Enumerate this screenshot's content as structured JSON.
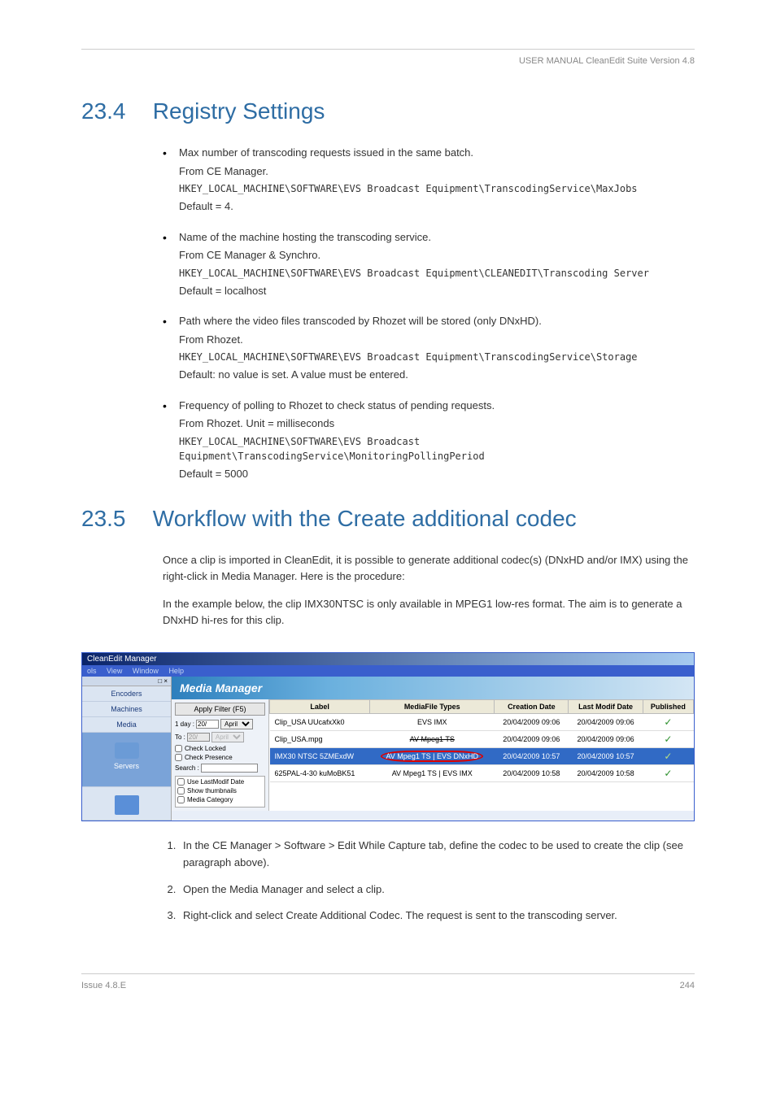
{
  "header": {
    "text": "USER MANUAL CleanEdit Suite Version 4.8"
  },
  "section_234": {
    "number": "23.4",
    "title": "Registry Settings",
    "items": [
      {
        "description": "Max number of transcoding requests issued in the same batch.",
        "source": "From CE Manager.",
        "regkey": "HKEY_LOCAL_MACHINE\\SOFTWARE\\EVS Broadcast Equipment\\TranscodingService\\MaxJobs",
        "default": "Default = 4."
      },
      {
        "description": "Name of the machine hosting the transcoding service.",
        "source": "From CE Manager & Synchro.",
        "regkey": "HKEY_LOCAL_MACHINE\\SOFTWARE\\EVS Broadcast Equipment\\CLEANEDIT\\Transcoding Server",
        "default": "Default = localhost"
      },
      {
        "description": "Path where the video files transcoded by Rhozet will be stored (only DNxHD).",
        "source": "From Rhozet.",
        "regkey": "HKEY_LOCAL_MACHINE\\SOFTWARE\\EVS Broadcast Equipment\\TranscodingService\\Storage",
        "default": "Default: no value is set. A value must be entered."
      },
      {
        "description": "Frequency of polling to Rhozet to check status of pending requests.",
        "source": "From Rhozet. Unit = milliseconds",
        "regkey": "HKEY_LOCAL_MACHINE\\SOFTWARE\\EVS Broadcast Equipment\\TranscodingService\\MonitoringPollingPeriod",
        "default": "Default = 5000"
      }
    ]
  },
  "section_235": {
    "number": "23.5",
    "title": "Workflow with the Create additional codec",
    "intro_p1": "Once a clip is imported in CleanEdit, it is possible to generate additional codec(s) (DNxHD and/or IMX) using the right-click in Media Manager. Here is the procedure:",
    "intro_p2": "In the example below, the clip IMX30NTSC is only available in MPEG1 low-res format. The aim is to generate a DNxHD hi-res for this clip.",
    "steps": [
      "In the CE Manager > Software > Edit While Capture tab, define the codec to be used to create the clip (see paragraph above).",
      "Open the Media Manager and select a clip.",
      "Right-click and select Create Additional Codec. The request is sent to the transcoding server."
    ]
  },
  "screenshot": {
    "title": "CleanEdit Manager",
    "menus": [
      "ols",
      "View",
      "Window",
      "Help"
    ],
    "sidebar_close": "□ ×",
    "sidebar_items": [
      "Encoders",
      "Machines",
      "Media",
      "Servers"
    ],
    "mm_header": "Media Manager",
    "filter_panel": {
      "apply_btn": "Apply Filter (F5)",
      "one_day_label": "1 day :",
      "one_day_val": "20/",
      "one_day_month": "April",
      "to_label": "To :",
      "to_val": "20/",
      "to_month": "April",
      "check_locked": "Check Locked",
      "check_presence": "Check Presence",
      "search_label": "Search :",
      "opt1": "Use LastModif Date",
      "opt2": "Show thumbnails",
      "opt3": "Media Category"
    },
    "table": {
      "headers": [
        "Label",
        "MediaFile Types",
        "Creation Date",
        "Last Modif Date",
        "Published"
      ],
      "rows": [
        {
          "label": "Clip_USA UUcafxXk0",
          "types": "EVS IMX",
          "created": "20/04/2009 09:06",
          "modified": "20/04/2009 09:06",
          "pub": "✓",
          "highlighted": false
        },
        {
          "label": "Clip_USA.mpg",
          "types": "AV Mpeg1 TS",
          "types_strike": true,
          "created": "20/04/2009 09:06",
          "modified": "20/04/2009 09:06",
          "pub": "✓",
          "highlighted": false
        },
        {
          "label": "IMX30 NTSC 5ZMExdW",
          "types": "AV Mpeg1 TS | EVS DNxHD",
          "types_circled": true,
          "created": "20/04/2009 10:57",
          "modified": "20/04/2009 10:57",
          "pub": "✓",
          "highlighted": true
        },
        {
          "label": "625PAL-4-30 kuMoBK51",
          "types": "AV Mpeg1 TS | EVS IMX",
          "created": "20/04/2009 10:58",
          "modified": "20/04/2009 10:58",
          "pub": "✓",
          "highlighted": false
        }
      ]
    }
  },
  "footer": {
    "left": "Issue 4.8.E",
    "right": "244"
  }
}
